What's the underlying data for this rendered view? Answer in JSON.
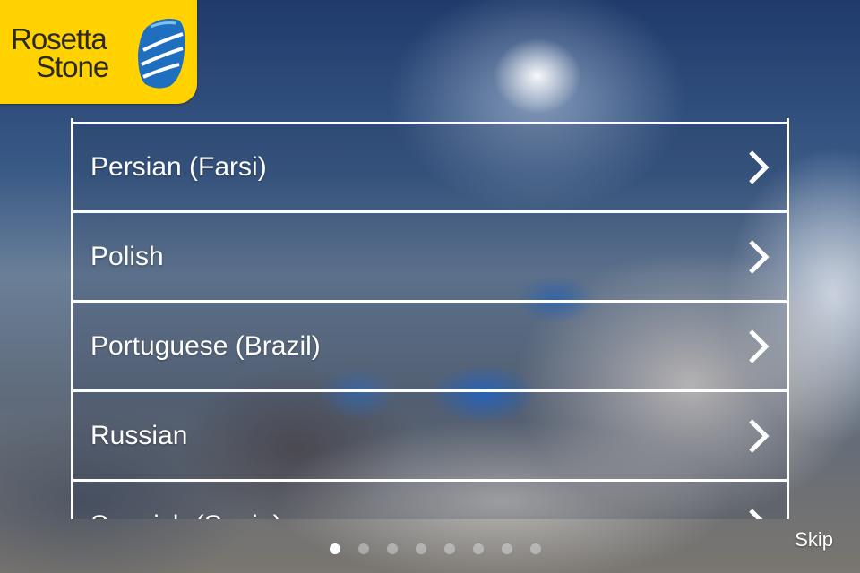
{
  "brand": {
    "line1": "Rosetta",
    "line2": "Stone",
    "color": "#ffd200"
  },
  "languages": [
    {
      "label": "Persian (Farsi)"
    },
    {
      "label": "Polish"
    },
    {
      "label": "Portuguese (Brazil)"
    },
    {
      "label": "Russian"
    },
    {
      "label": "Spanish (Spain)"
    }
  ],
  "row_icon": "chevron-right-icon",
  "pager": {
    "total": 8,
    "current": 1
  },
  "skip_label": "Skip"
}
